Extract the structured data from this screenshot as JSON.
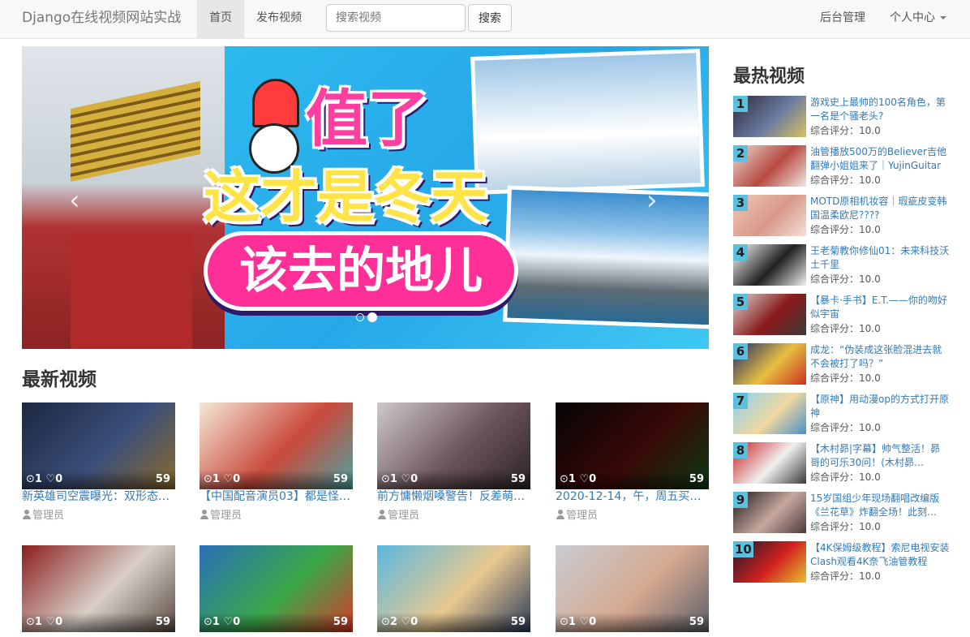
{
  "navbar": {
    "brand": "Django在线视频网站实战",
    "nav_home": "首页",
    "nav_publish": "发布视频",
    "search_placeholder": "搜索视频",
    "search_button": "搜索",
    "admin": "后台管理",
    "user_center": "个人中心"
  },
  "carousel": {
    "line1": "值了",
    "line2": "这才是冬天",
    "line3": "该去的地儿",
    "prev_glyph": "‹",
    "next_glyph": "›",
    "active_slide": 2,
    "slide_count": 2
  },
  "latest": {
    "title": "最新视频",
    "videos": [
      {
        "views": "1",
        "likes": "0",
        "duration": "59",
        "title": "新英雄司空震曝光：双形态…",
        "author": "管理员",
        "thumb_colors": [
          "#1d2740",
          "#3a4f7a",
          "#8b6a2c"
        ]
      },
      {
        "views": "1",
        "likes": "0",
        "duration": "59",
        "title": "【中国配音演员03】都是怪…",
        "author": "管理员",
        "thumb_colors": [
          "#f4e8d8",
          "#c94a3a",
          "#4fa3a0"
        ]
      },
      {
        "views": "1",
        "likes": "0",
        "duration": "59",
        "title": "前方慵懒烟嗓警告！反差萌…",
        "author": "管理员",
        "thumb_colors": [
          "#cfc9cc",
          "#6b5459",
          "#2b2426"
        ]
      },
      {
        "views": "1",
        "likes": "0",
        "duration": "59",
        "title": "2020-12-14，午，周五买的…",
        "author": "管理员",
        "thumb_colors": [
          "#050505",
          "#3a0808",
          "#0a3a12"
        ]
      },
      {
        "views": "1",
        "likes": "0",
        "duration": "59",
        "title": "",
        "author": "",
        "thumb_colors": [
          "#8a1f1f",
          "#d8d0c8",
          "#5a4a40"
        ]
      },
      {
        "views": "1",
        "likes": "0",
        "duration": "59",
        "title": "",
        "author": "",
        "thumb_colors": [
          "#2a6fb8",
          "#3aa84a",
          "#d63a2a"
        ]
      },
      {
        "views": "2",
        "likes": "0",
        "duration": "59",
        "title": "",
        "author": "",
        "thumb_colors": [
          "#5ab8e0",
          "#e8c890",
          "#2a3a5a"
        ]
      },
      {
        "views": "1",
        "likes": "0",
        "duration": "59",
        "title": "",
        "author": "",
        "thumb_colors": [
          "#c8ccd2",
          "#d6a890",
          "#5a6068"
        ]
      }
    ]
  },
  "hot": {
    "title": "最热视频",
    "score_label": "综合评分：",
    "items": [
      {
        "rank": "1",
        "title": "游戏史上最帅的100名角色，第一名是个骚老头?",
        "score": "10.0",
        "thumb_colors": [
          "#2a2a3a",
          "#6a7aa0",
          "#d8c060"
        ]
      },
      {
        "rank": "2",
        "title": "油管播放500万的Believer吉他翻弹小姐姐来了｜YujinGuitar",
        "score": "10.0",
        "thumb_colors": [
          "#e8dcd8",
          "#b84a40",
          "#f0e8e4"
        ]
      },
      {
        "rank": "3",
        "title": "MOTD原相机妆容｜瑕疵皮变韩国温柔欧尼????",
        "score": "10.0",
        "thumb_colors": [
          "#f0c8b8",
          "#d8988a",
          "#f4e0d8"
        ]
      },
      {
        "rank": "4",
        "title": "王老菊教你修仙01：未来科技沃土千里",
        "score": "10.0",
        "thumb_colors": [
          "#ffffff",
          "#202020",
          "#f0f0f0"
        ]
      },
      {
        "rank": "5",
        "title": "【暴卡·手书】E.T.——你的吻好似宇宙",
        "score": "10.0",
        "thumb_colors": [
          "#d8d8d8",
          "#8a1a1a",
          "#3a3a3a"
        ]
      },
      {
        "rank": "6",
        "title": "成龙：“伪装成这张脸混进去就不会被打了吗？”",
        "score": "10.0",
        "thumb_colors": [
          "#1a2a6a",
          "#e8c040",
          "#c83020"
        ]
      },
      {
        "rank": "7",
        "title": "【原神】用动漫op的方式打开原神",
        "score": "10.0",
        "thumb_colors": [
          "#8ad0f0",
          "#f0d8a0",
          "#4a90c8"
        ]
      },
      {
        "rank": "8",
        "title": "【木村昴|字幕】帅气整活！昴哥的可乐30问！(木村昴…",
        "score": "10.0",
        "thumb_colors": [
          "#c82020",
          "#f0f0f0",
          "#3a3a3a"
        ]
      },
      {
        "rank": "9",
        "title": "15岁国组少年现场翻唱改编版《兰花草》炸翻全场！此刻…",
        "score": "10.0",
        "thumb_colors": [
          "#1a1a1a",
          "#c8a8a0",
          "#4a3a3a"
        ]
      },
      {
        "rank": "10",
        "title": "【4K保姆级教程】索尼电视安装Clash观看4K奈飞油管教程",
        "score": "10.0",
        "thumb_colors": [
          "#1a1a2a",
          "#d02020",
          "#e8c030"
        ]
      }
    ]
  }
}
